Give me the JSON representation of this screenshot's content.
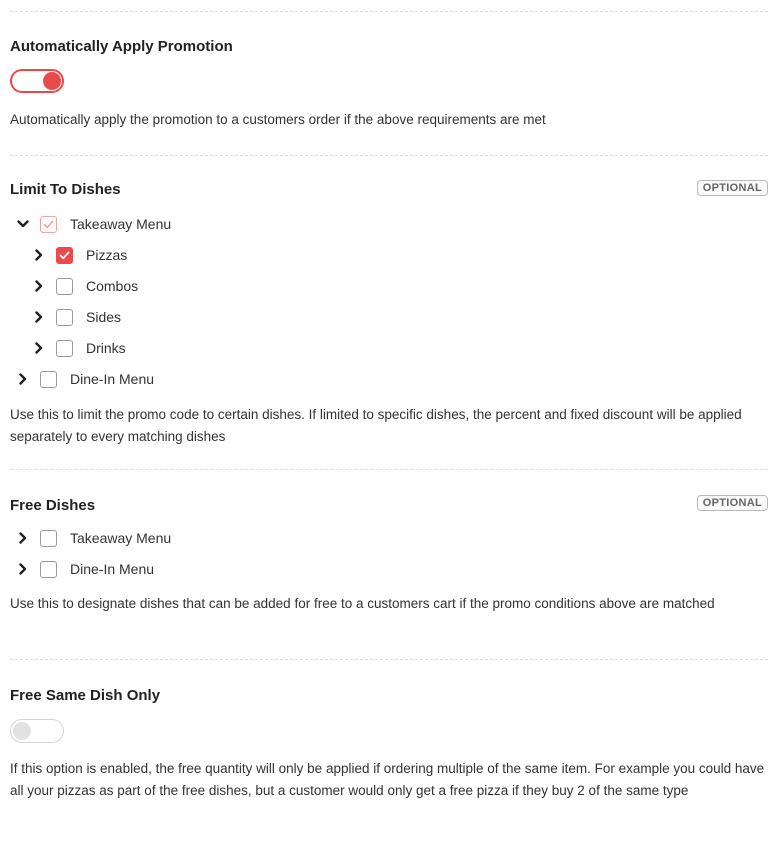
{
  "auto_apply": {
    "title": "Automatically Apply Promotion",
    "enabled": true,
    "description": "Automatically apply the promotion to a customers order if the above requirements are met"
  },
  "limit_dishes": {
    "title": "Limit To Dishes",
    "badge": "OPTIONAL",
    "tree": {
      "takeaway": "Takeaway Menu",
      "pizzas": "Pizzas",
      "combos": "Combos",
      "sides": "Sides",
      "drinks": "Drinks",
      "dinein": "Dine-In Menu"
    },
    "description": "Use this to limit the promo code to certain dishes. If limited to specific dishes, the percent and fixed discount will be applied separately to every matching dishes"
  },
  "free_dishes": {
    "title": "Free Dishes",
    "badge": "OPTIONAL",
    "tree": {
      "takeaway": "Takeaway Menu",
      "dinein": "Dine-In Menu"
    },
    "description": "Use this to designate dishes that can be added for free to a customers cart if the promo conditions above are matched"
  },
  "free_same": {
    "title": "Free Same Dish Only",
    "enabled": false,
    "description": "If this option is enabled, the free quantity will only be applied if ordering multiple of the same item. For example you could have all your pizzas as part of the free dishes, but a customer would only get a free pizza if they buy 2 of the same type"
  },
  "colors": {
    "accent": "#ea4a4a",
    "divider": "#dcdcdc",
    "text": "#333333"
  },
  "icons": {
    "expand": "chevron-right-icon",
    "collapse": "chevron-down-icon",
    "check": "check-icon"
  }
}
